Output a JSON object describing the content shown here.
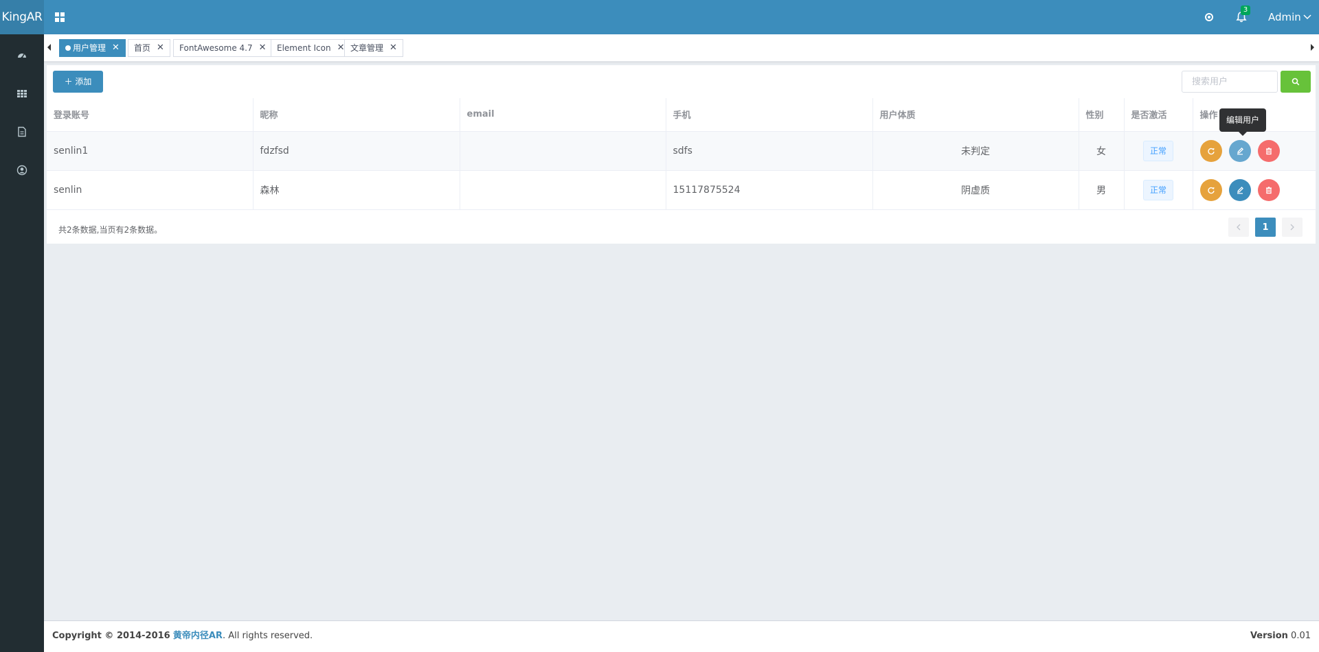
{
  "app": {
    "logo": "KingAR"
  },
  "header": {
    "notification_count": "3",
    "user": "Admin"
  },
  "sidebar": {
    "items": [
      {
        "icon": "dashboard-icon"
      },
      {
        "icon": "apps-grid-icon"
      },
      {
        "icon": "document-icon"
      },
      {
        "icon": "user-circle-icon"
      }
    ]
  },
  "tabs": [
    {
      "label": "用户管理",
      "active": true
    },
    {
      "label": "首页",
      "active": false
    },
    {
      "label": "FontAwesome 4.7",
      "active": false
    },
    {
      "label": "Element Icon",
      "active": false
    },
    {
      "label": "文章管理",
      "active": false
    }
  ],
  "toolbar": {
    "add_label": "添加",
    "search_placeholder": "搜索用户"
  },
  "table": {
    "columns": [
      "登录账号",
      "昵称",
      "email",
      "手机",
      "用户体质",
      "性别",
      "是否激活",
      "操作"
    ],
    "rows": [
      {
        "account": "senlin1",
        "nickname": "fdzfsd",
        "email": "",
        "phone": "sdfs",
        "constitution": "未判定",
        "gender": "女",
        "active": "正常"
      },
      {
        "account": "senlin",
        "nickname": "森林",
        "email": "",
        "phone": "15117875524",
        "constitution": "阴虚质",
        "gender": "男",
        "active": "正常"
      }
    ],
    "tooltip": "编辑用户"
  },
  "pagination": {
    "summary": "共2条数据,当页有2条数据。",
    "current_page": "1"
  },
  "footer": {
    "copyright_prefix": "Copyright © 2014-2016",
    "brand": "黄帝内径AR",
    "copyright_suffix": ". All rights reserved.",
    "version_label": "Version",
    "version_value": "0.01"
  },
  "colors": {
    "header": "#3c8dbc",
    "sidebar": "#222d32",
    "refresh_button": "#e6a23c",
    "edit_button": "#3c8dbc",
    "delete_button": "#f56c6c",
    "search_button": "#67c23a"
  }
}
